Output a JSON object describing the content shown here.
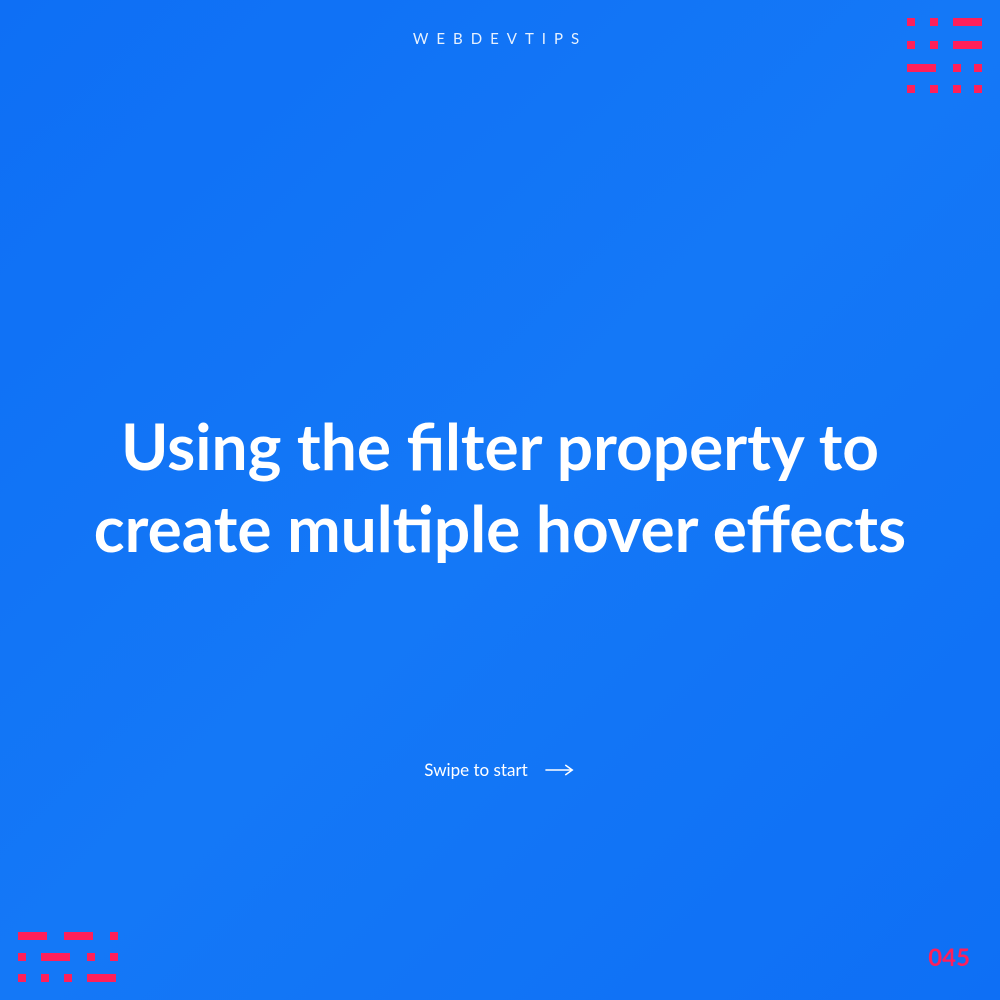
{
  "header": {
    "brand": "WEBDEVTIPS"
  },
  "main": {
    "title": "Using the filter property to create multiple hover effects"
  },
  "cta": {
    "swipe_label": "Swipe to start"
  },
  "footer": {
    "page_number": "045"
  },
  "colors": {
    "background": "#0e6ff5",
    "accent": "#ff1f5a",
    "text": "#ffffff"
  }
}
